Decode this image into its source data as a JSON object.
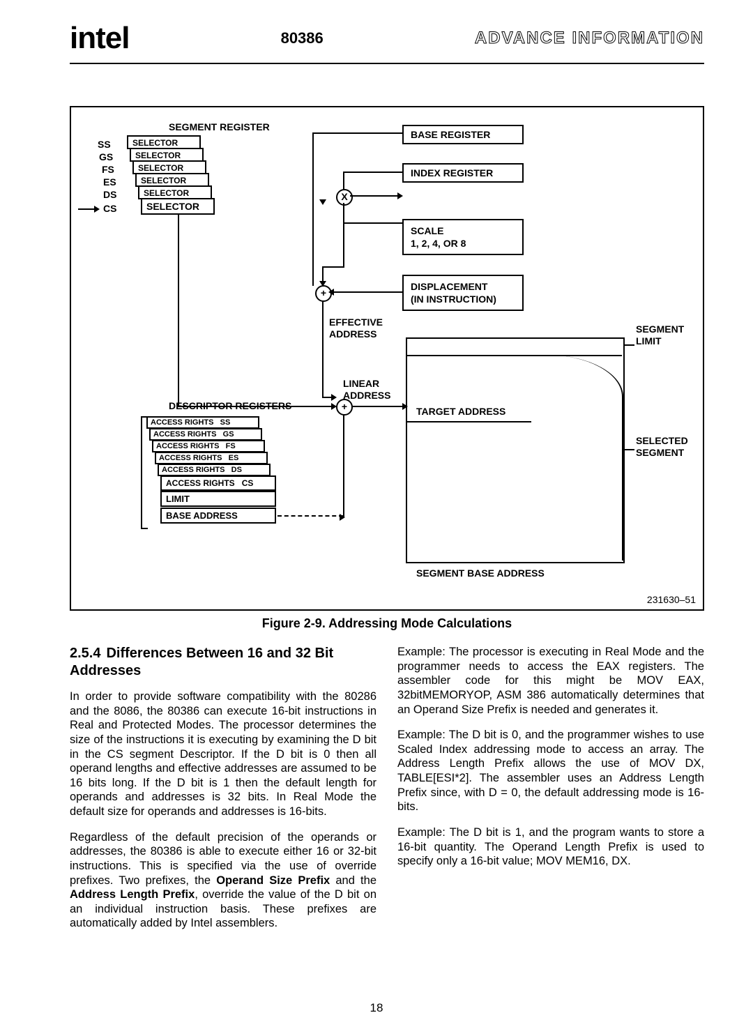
{
  "header": {
    "logo": "intel",
    "chip": "80386",
    "right": "ADVANCE INFORMATION"
  },
  "fig": {
    "segreg_title": "SEGMENT REGISTER",
    "segs": [
      "SS",
      "GS",
      "FS",
      "ES",
      "DS",
      "CS"
    ],
    "selector": "SELECTOR",
    "basereg": "BASE REGISTER",
    "indexreg": "INDEX REGISTER",
    "scale_l1": "SCALE",
    "scale_l2": "1, 2, 4, OR 8",
    "disp_l1": "DISPLACEMENT",
    "disp_l2": "(IN INSTRUCTION)",
    "eff_l1": "EFFECTIVE",
    "eff_l2": "ADDRESS",
    "lin_l1": "LINEAR",
    "lin_l2": "ADDRESS",
    "descreg": "DESCRIPTOR REGISTERS",
    "ar": "ACCESS RIGHTS",
    "limit": "LIMIT",
    "base": "BASE ADDRESS",
    "target": "TARGET ADDRESS",
    "seglimit": "SEGMENT\nLIMIT",
    "selseg": "SELECTED\nSEGMENT",
    "segbase": "SEGMENT BASE ADDRESS",
    "ref": "231630–51",
    "caption": "Figure 2-9. Addressing Mode Calculations"
  },
  "section": {
    "num": "2.5.4",
    "title": "Differences Between 16 and 32 Bit Addresses"
  },
  "p1": "In order to provide software compatibility with the 80286 and the 8086, the 80386 can execute 16-bit instructions in Real and Protected Modes. The processor determines the size of the instructions it is executing by examining the D bit in the CS segment Descriptor. If the D bit is 0 then all operand lengths and effective addresses are assumed to be 16 bits long. If the D bit is 1 then the default length for operands and addresses is 32 bits. In Real Mode the default size for operands and addresses is 16-bits.",
  "p2a": "Regardless of the default precision of the operands or addresses, the 80386 is able to execute either 16 or 32-bit instructions. This is specified via the use of override prefixes. Two prefixes, the ",
  "p2b": "Operand Size Prefix",
  "p2c": " and the ",
  "p2d": "Address Length Prefix",
  "p2e": ", override the value of the D bit on an individual instruction basis. These prefixes are automatically added by Intel assemblers.",
  "p3": "Example: The processor is executing in Real Mode and the programmer needs to access the EAX registers. The assembler code for this might be MOV EAX, 32bitMEMORYOP, ASM 386 automatically determines that an Operand Size Prefix is needed and generates it.",
  "p4": "Example: The D bit is 0, and the programmer wishes to use Scaled Index addressing mode to access an array. The Address Length Prefix allows the use of MOV DX, TABLE[ESI*2]. The assembler uses an Address Length Prefix since, with D = 0, the default addressing mode is 16-bits.",
  "p5": "Example: The D bit is 1, and the program wants to store a 16-bit quantity. The Operand Length Prefix is used to specify only a 16-bit value; MOV MEM16, DX.",
  "pageno": "18"
}
